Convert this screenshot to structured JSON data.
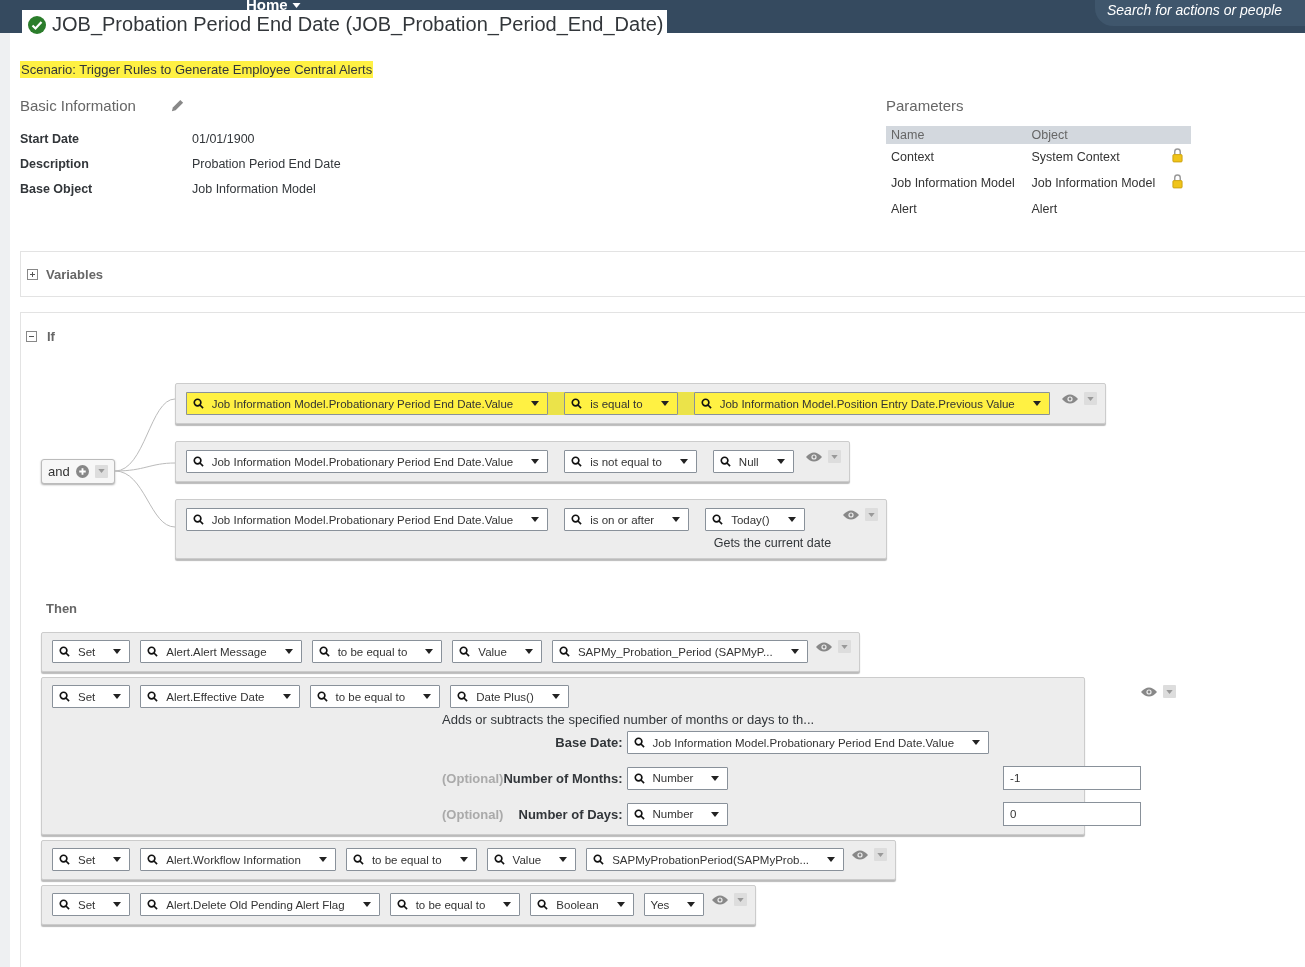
{
  "header": {
    "nav_label": "Home",
    "search_placeholder": "Search for actions or people"
  },
  "title": {
    "text": "JOB_Probation Period End Date (JOB_Probation_Period_End_Date)"
  },
  "scenario": "Scenario: Trigger Rules to Generate Employee Central Alerts",
  "basic_info": {
    "title": "Basic Information",
    "fields": [
      {
        "label": "Start Date",
        "value": "01/01/1900"
      },
      {
        "label": "Description",
        "value": "Probation Period End Date"
      },
      {
        "label": "Base Object",
        "value": "Job Information Model"
      }
    ]
  },
  "parameters": {
    "title": "Parameters",
    "columns": [
      "Name",
      "Object"
    ],
    "rows": [
      {
        "name": "Context",
        "object": "System Context",
        "locked": true
      },
      {
        "name": "Job Information Model",
        "object": "Job Information Model",
        "locked": true
      },
      {
        "name": "Alert",
        "object": "Alert",
        "locked": false
      }
    ]
  },
  "variables": {
    "label": "Variables",
    "expanded": false
  },
  "if_section": {
    "label": "If",
    "expanded": true
  },
  "conditions": {
    "operator": "and",
    "rows": [
      {
        "highlighted": true,
        "fields": [
          {
            "text": "Job Information Model.Probationary Period End Date.Value",
            "search": true
          },
          {
            "text": "is equal to",
            "search": true
          },
          {
            "text": "Job Information Model.Position Entry Date.Previous Value",
            "search": true
          }
        ]
      },
      {
        "highlighted": false,
        "fields": [
          {
            "text": "Job Information Model.Probationary Period End Date.Value",
            "search": true
          },
          {
            "text": "is not equal to",
            "search": true
          },
          {
            "text": "Null",
            "search": true
          }
        ]
      },
      {
        "highlighted": false,
        "fields": [
          {
            "text": "Job Information Model.Probationary Period End Date.Value",
            "search": true
          },
          {
            "text": "is on or after",
            "search": true
          },
          {
            "text": "Today()",
            "search": true
          }
        ],
        "hint": "Gets the current date"
      }
    ]
  },
  "then_label": "Then",
  "actions": [
    {
      "fields": [
        {
          "text": "Set",
          "search": true
        },
        {
          "text": "Alert.Alert Message",
          "search": true
        },
        {
          "text": "to be equal to",
          "search": true
        },
        {
          "text": "Value",
          "search": true
        },
        {
          "text": "SAPMy_Probation_Period (SAPMyP...",
          "search": true
        }
      ]
    },
    {
      "fields": [
        {
          "text": "Set",
          "search": true
        },
        {
          "text": "Alert.Effective Date",
          "search": true
        },
        {
          "text": "to be equal to",
          "search": true
        },
        {
          "text": "Date Plus()",
          "search": true
        }
      ],
      "description": "Adds or subtracts the specified number of months or days to th...",
      "params": [
        {
          "label": "Base Date:",
          "field": {
            "text": "Job Information Model.Probationary Period End Date.Value",
            "search": true
          }
        },
        {
          "optional": "(Optional)",
          "label": "Number of Months:",
          "field": {
            "text": "Number",
            "search": true
          },
          "value": "-1"
        },
        {
          "optional": "(Optional)",
          "label": "Number of Days:",
          "field": {
            "text": "Number",
            "search": true
          },
          "value": "0"
        }
      ]
    },
    {
      "fields": [
        {
          "text": "Set",
          "search": true
        },
        {
          "text": "Alert.Workflow Information",
          "search": true
        },
        {
          "text": "to be equal to",
          "search": true
        },
        {
          "text": "Value",
          "search": true
        },
        {
          "text": "SAPMyProbationPeriod(SAPMyProb...",
          "search": true
        }
      ]
    },
    {
      "fields": [
        {
          "text": "Set",
          "search": true
        },
        {
          "text": "Alert.Delete Old Pending Alert Flag",
          "search": true
        },
        {
          "text": "to be equal to",
          "search": true
        },
        {
          "text": "Boolean",
          "search": true
        },
        {
          "text": "Yes",
          "search": false
        }
      ]
    }
  ]
}
